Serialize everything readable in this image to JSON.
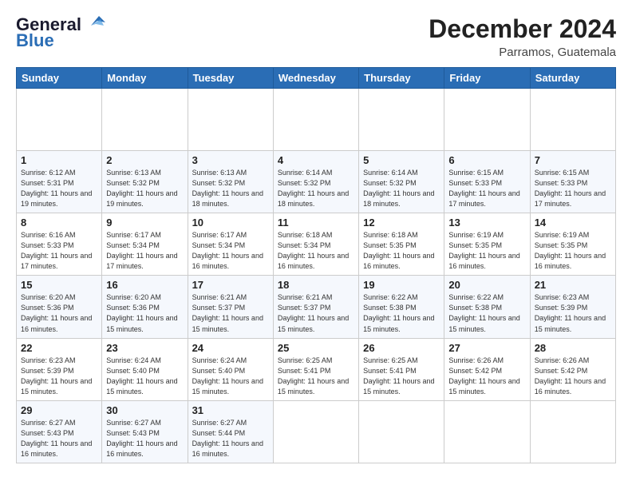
{
  "header": {
    "logo_line1": "General",
    "logo_line2": "Blue",
    "title": "December 2024",
    "subtitle": "Parramos, Guatemala"
  },
  "calendar": {
    "days_of_week": [
      "Sunday",
      "Monday",
      "Tuesday",
      "Wednesday",
      "Thursday",
      "Friday",
      "Saturday"
    ],
    "weeks": [
      [
        null,
        null,
        null,
        null,
        null,
        null,
        null
      ]
    ],
    "cells": [
      [
        {
          "day": null
        },
        {
          "day": null
        },
        {
          "day": null
        },
        {
          "day": null
        },
        {
          "day": null
        },
        {
          "day": null
        },
        {
          "day": null
        }
      ],
      [
        {
          "day": 1,
          "sunrise": "6:12 AM",
          "sunset": "5:31 PM",
          "daylight": "11 hours and 19 minutes."
        },
        {
          "day": 2,
          "sunrise": "6:13 AM",
          "sunset": "5:32 PM",
          "daylight": "11 hours and 19 minutes."
        },
        {
          "day": 3,
          "sunrise": "6:13 AM",
          "sunset": "5:32 PM",
          "daylight": "11 hours and 18 minutes."
        },
        {
          "day": 4,
          "sunrise": "6:14 AM",
          "sunset": "5:32 PM",
          "daylight": "11 hours and 18 minutes."
        },
        {
          "day": 5,
          "sunrise": "6:14 AM",
          "sunset": "5:32 PM",
          "daylight": "11 hours and 18 minutes."
        },
        {
          "day": 6,
          "sunrise": "6:15 AM",
          "sunset": "5:33 PM",
          "daylight": "11 hours and 17 minutes."
        },
        {
          "day": 7,
          "sunrise": "6:15 AM",
          "sunset": "5:33 PM",
          "daylight": "11 hours and 17 minutes."
        }
      ],
      [
        {
          "day": 8,
          "sunrise": "6:16 AM",
          "sunset": "5:33 PM",
          "daylight": "11 hours and 17 minutes."
        },
        {
          "day": 9,
          "sunrise": "6:17 AM",
          "sunset": "5:34 PM",
          "daylight": "11 hours and 17 minutes."
        },
        {
          "day": 10,
          "sunrise": "6:17 AM",
          "sunset": "5:34 PM",
          "daylight": "11 hours and 16 minutes."
        },
        {
          "day": 11,
          "sunrise": "6:18 AM",
          "sunset": "5:34 PM",
          "daylight": "11 hours and 16 minutes."
        },
        {
          "day": 12,
          "sunrise": "6:18 AM",
          "sunset": "5:35 PM",
          "daylight": "11 hours and 16 minutes."
        },
        {
          "day": 13,
          "sunrise": "6:19 AM",
          "sunset": "5:35 PM",
          "daylight": "11 hours and 16 minutes."
        },
        {
          "day": 14,
          "sunrise": "6:19 AM",
          "sunset": "5:35 PM",
          "daylight": "11 hours and 16 minutes."
        }
      ],
      [
        {
          "day": 15,
          "sunrise": "6:20 AM",
          "sunset": "5:36 PM",
          "daylight": "11 hours and 16 minutes."
        },
        {
          "day": 16,
          "sunrise": "6:20 AM",
          "sunset": "5:36 PM",
          "daylight": "11 hours and 15 minutes."
        },
        {
          "day": 17,
          "sunrise": "6:21 AM",
          "sunset": "5:37 PM",
          "daylight": "11 hours and 15 minutes."
        },
        {
          "day": 18,
          "sunrise": "6:21 AM",
          "sunset": "5:37 PM",
          "daylight": "11 hours and 15 minutes."
        },
        {
          "day": 19,
          "sunrise": "6:22 AM",
          "sunset": "5:38 PM",
          "daylight": "11 hours and 15 minutes."
        },
        {
          "day": 20,
          "sunrise": "6:22 AM",
          "sunset": "5:38 PM",
          "daylight": "11 hours and 15 minutes."
        },
        {
          "day": 21,
          "sunrise": "6:23 AM",
          "sunset": "5:39 PM",
          "daylight": "11 hours and 15 minutes."
        }
      ],
      [
        {
          "day": 22,
          "sunrise": "6:23 AM",
          "sunset": "5:39 PM",
          "daylight": "11 hours and 15 minutes."
        },
        {
          "day": 23,
          "sunrise": "6:24 AM",
          "sunset": "5:40 PM",
          "daylight": "11 hours and 15 minutes."
        },
        {
          "day": 24,
          "sunrise": "6:24 AM",
          "sunset": "5:40 PM",
          "daylight": "11 hours and 15 minutes."
        },
        {
          "day": 25,
          "sunrise": "6:25 AM",
          "sunset": "5:41 PM",
          "daylight": "11 hours and 15 minutes."
        },
        {
          "day": 26,
          "sunrise": "6:25 AM",
          "sunset": "5:41 PM",
          "daylight": "11 hours and 15 minutes."
        },
        {
          "day": 27,
          "sunrise": "6:26 AM",
          "sunset": "5:42 PM",
          "daylight": "11 hours and 15 minutes."
        },
        {
          "day": 28,
          "sunrise": "6:26 AM",
          "sunset": "5:42 PM",
          "daylight": "11 hours and 16 minutes."
        }
      ],
      [
        {
          "day": 29,
          "sunrise": "6:27 AM",
          "sunset": "5:43 PM",
          "daylight": "11 hours and 16 minutes."
        },
        {
          "day": 30,
          "sunrise": "6:27 AM",
          "sunset": "5:43 PM",
          "daylight": "11 hours and 16 minutes."
        },
        {
          "day": 31,
          "sunrise": "6:27 AM",
          "sunset": "5:44 PM",
          "daylight": "11 hours and 16 minutes."
        },
        {
          "day": null
        },
        {
          "day": null
        },
        {
          "day": null
        },
        {
          "day": null
        }
      ]
    ]
  }
}
